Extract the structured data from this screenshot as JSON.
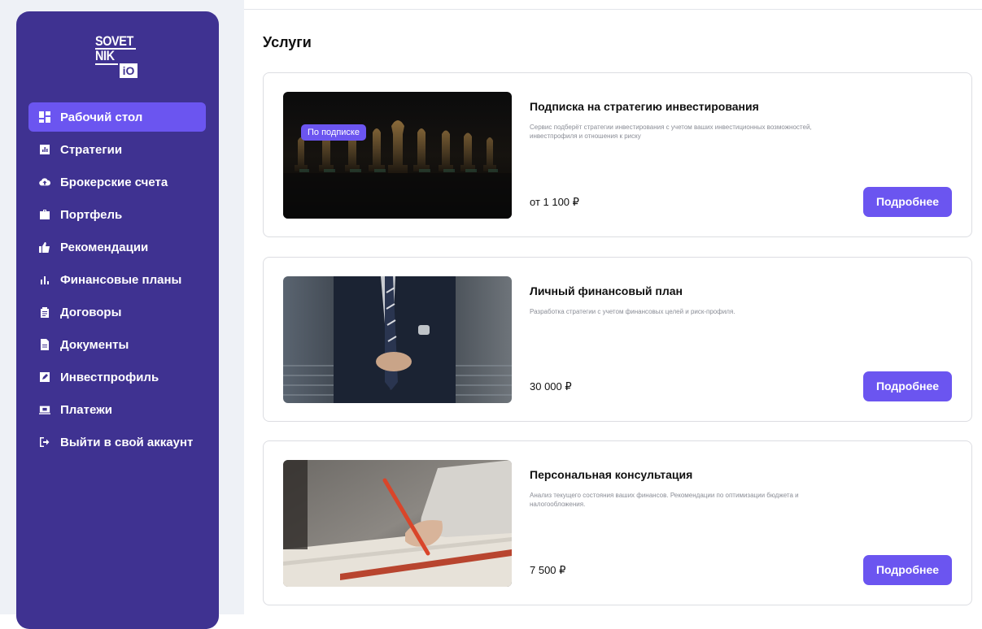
{
  "brand": {
    "line1": "SOVET",
    "line2": "NIK",
    "suffix": "iO"
  },
  "sidebar": {
    "items": [
      {
        "label": "Рабочий стол",
        "icon": "dashboard-icon",
        "active": true
      },
      {
        "label": "Стратегии",
        "icon": "chart-box-icon"
      },
      {
        "label": "Брокерские счета",
        "icon": "cloud-upload-icon"
      },
      {
        "label": "Портфель",
        "icon": "briefcase-icon"
      },
      {
        "label": "Рекомендации",
        "icon": "thumbs-up-icon"
      },
      {
        "label": "Финансовые планы",
        "icon": "bar-chart-icon"
      },
      {
        "label": "Договоры",
        "icon": "clipboard-icon"
      },
      {
        "label": "Документы",
        "icon": "document-icon"
      },
      {
        "label": "Инвестпрофиль",
        "icon": "edit-icon"
      },
      {
        "label": "Платежи",
        "icon": "payment-icon"
      },
      {
        "label": "Выйти в свой аккаунт",
        "icon": "logout-icon"
      }
    ]
  },
  "main": {
    "title": "Услуги",
    "services": [
      {
        "badge": "По подписке",
        "title": "Подписка на стратегию инвестирования",
        "description": "Сервис подберёт стратегии инвестирования с учетом ваших инвестиционных возможностей, инвестпрофиля и отношения к риску",
        "price": "от 1 100 ₽",
        "button": "Подробнее",
        "image": "chess-pieces"
      },
      {
        "badge": "",
        "title": "Личный финансовый план",
        "description": "Разработка стратегии с учетом финансовых целей и риск-профиля.",
        "price": "30 000 ₽",
        "button": "Подробнее",
        "image": "businessman-suit"
      },
      {
        "badge": "",
        "title": "Персональная консультация",
        "description": "Анализ текущего состояния ваших финансов. Рекомендации по оптимизации бюджета и налогообложения.",
        "price": "7 500 ₽",
        "button": "Подробнее",
        "image": "hand-writing"
      }
    ]
  },
  "colors": {
    "sidebar": "#3f3291",
    "accent": "#6b55f0",
    "page_bg": "#eef1f6"
  }
}
